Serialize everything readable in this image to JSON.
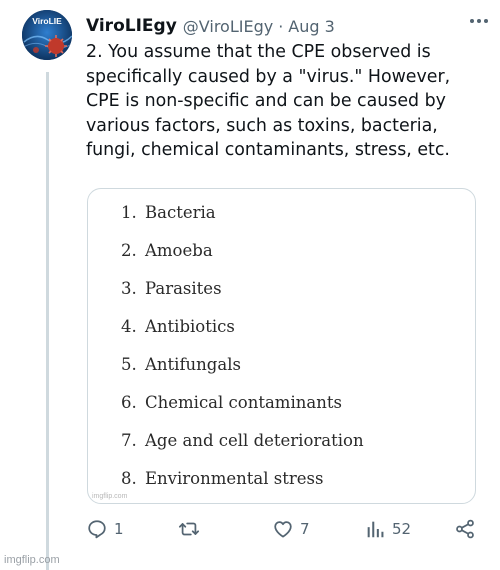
{
  "author": {
    "display_name": "ViroLIEgy",
    "handle": "@ViroLIEgy",
    "separator": "·",
    "date": "Aug 3",
    "avatar_text": "ViroLIE"
  },
  "tweet": {
    "text": "2. You assume that the CPE observed is specifically caused by a \"virus.\" However, CPE is non-specific and can be caused by various factors, such as toxins, bacteria, fungi, chemical contaminants, stress, etc."
  },
  "media": {
    "list_items": [
      {
        "num": "1.",
        "label": "Bacteria"
      },
      {
        "num": "2.",
        "label": "Amoeba"
      },
      {
        "num": "3.",
        "label": "Parasites"
      },
      {
        "num": "4.",
        "label": "Antibiotics"
      },
      {
        "num": "5.",
        "label": "Antifungals"
      },
      {
        "num": "6.",
        "label": "Chemical contaminants"
      },
      {
        "num": "7.",
        "label": "Age and cell deterioration"
      },
      {
        "num": "8.",
        "label": "Environmental stress"
      }
    ],
    "watermark": "imgflip.com"
  },
  "actions": {
    "replies": "1",
    "retweets": "",
    "likes": "7",
    "views": "52"
  },
  "page_watermark": "imgflip.com",
  "colors": {
    "text": "#0f1419",
    "muted": "#536471",
    "border": "#cfd9de",
    "avatar_bg": "#0d3b6e",
    "virus_red": "#c0392b"
  }
}
